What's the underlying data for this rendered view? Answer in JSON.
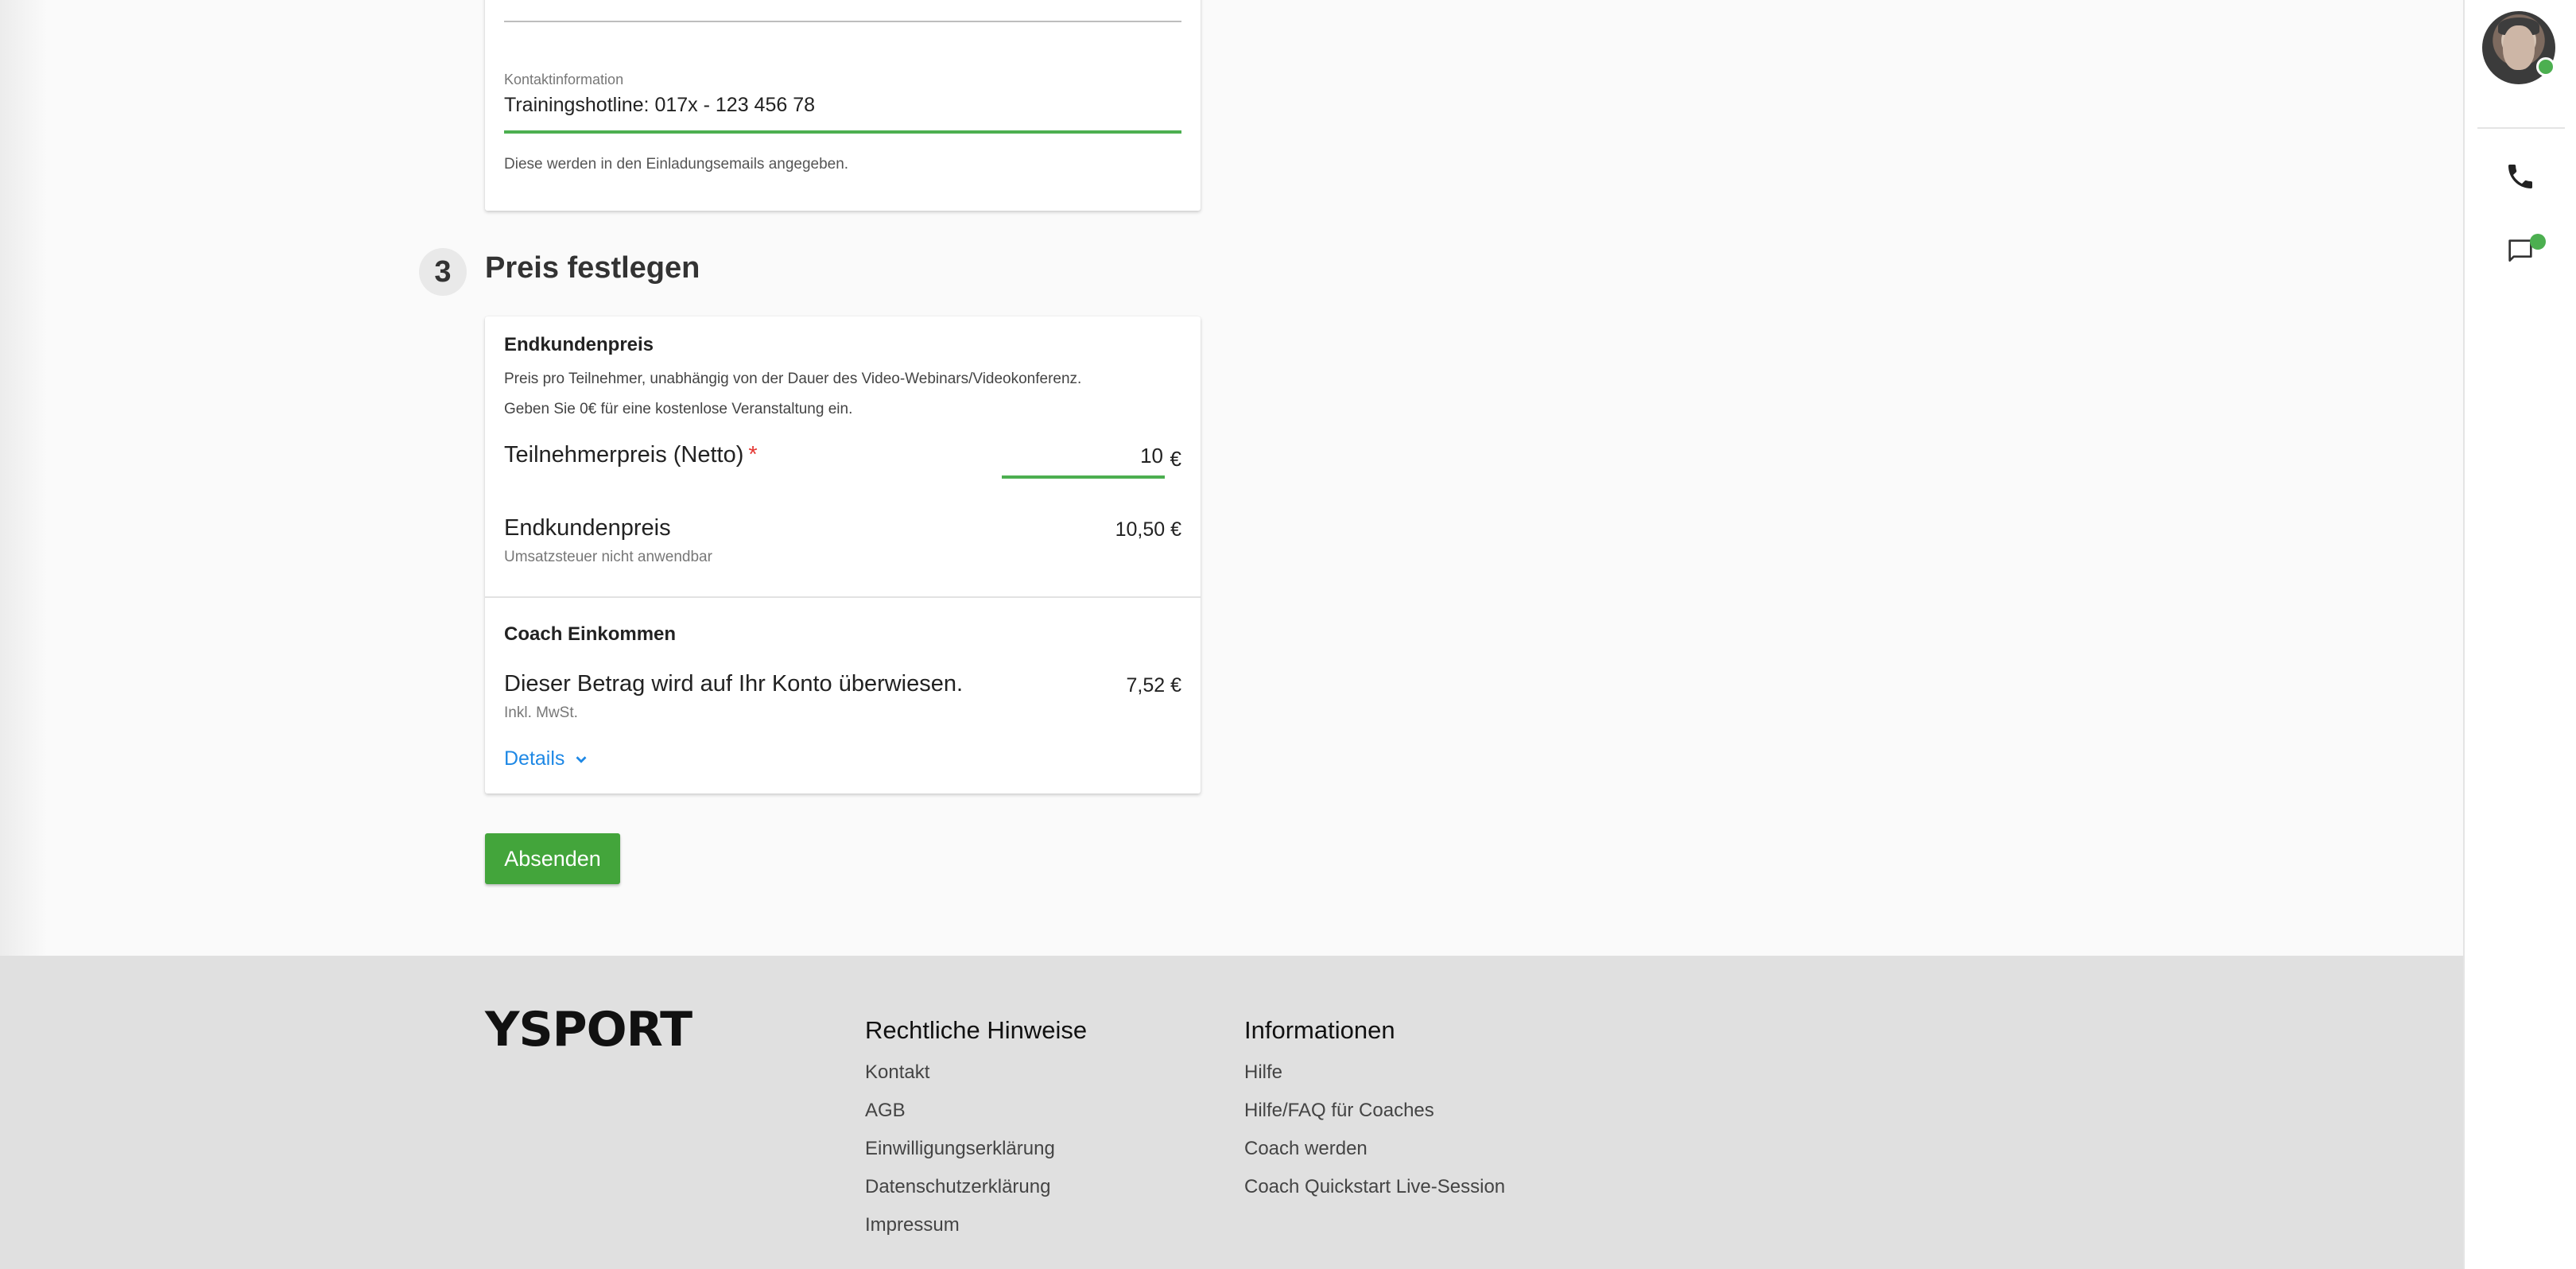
{
  "contact_section": {
    "label": "Kontaktinformation",
    "value": "Trainingshotline: 017x - 123 456 78",
    "helper": "Diese werden in den Einladungsemails angegeben."
  },
  "step": {
    "number": "3",
    "title": "Preis festlegen"
  },
  "price": {
    "section_title": "Endkundenpreis",
    "desc_line1": "Preis pro Teilnehmer, unabhängig von der Dauer des Video-Webinars/Videokonferenz.",
    "desc_line2": "Geben Sie 0€ für eine kostenlose Veranstaltung ein.",
    "participant_label": "Teilnehmerpreis (Netto)",
    "required_mark": "*",
    "participant_value": "10",
    "currency": "€",
    "endprice_label": "Endkundenpreis",
    "endprice_sub": "Umsatzsteuer nicht anwendbar",
    "endprice_value": "10,50 €"
  },
  "coach": {
    "section_title": "Coach Einkommen",
    "label": "Dieser Betrag wird auf Ihr Konto überwiesen.",
    "sub": "Inkl. MwSt.",
    "value": "7,52 €",
    "details_link": "Details"
  },
  "submit_label": "Absenden",
  "footer": {
    "logo": "YSPORT",
    "legal": {
      "title": "Rechtliche Hinweise",
      "links": [
        "Kontakt",
        "AGB",
        "Einwilligungserklärung",
        "Datenschutzerklärung",
        "Impressum"
      ]
    },
    "info": {
      "title": "Informationen",
      "links": [
        "Hilfe",
        "Hilfe/FAQ für Coaches",
        "Coach werden",
        "Coach Quickstart Live-Session"
      ]
    }
  },
  "rail": {
    "icons": [
      "avatar",
      "phone-icon",
      "chat-icon"
    ]
  },
  "colors": {
    "accent_green": "#43a53b",
    "link_blue": "#1e88e5",
    "required_red": "#e53935"
  }
}
